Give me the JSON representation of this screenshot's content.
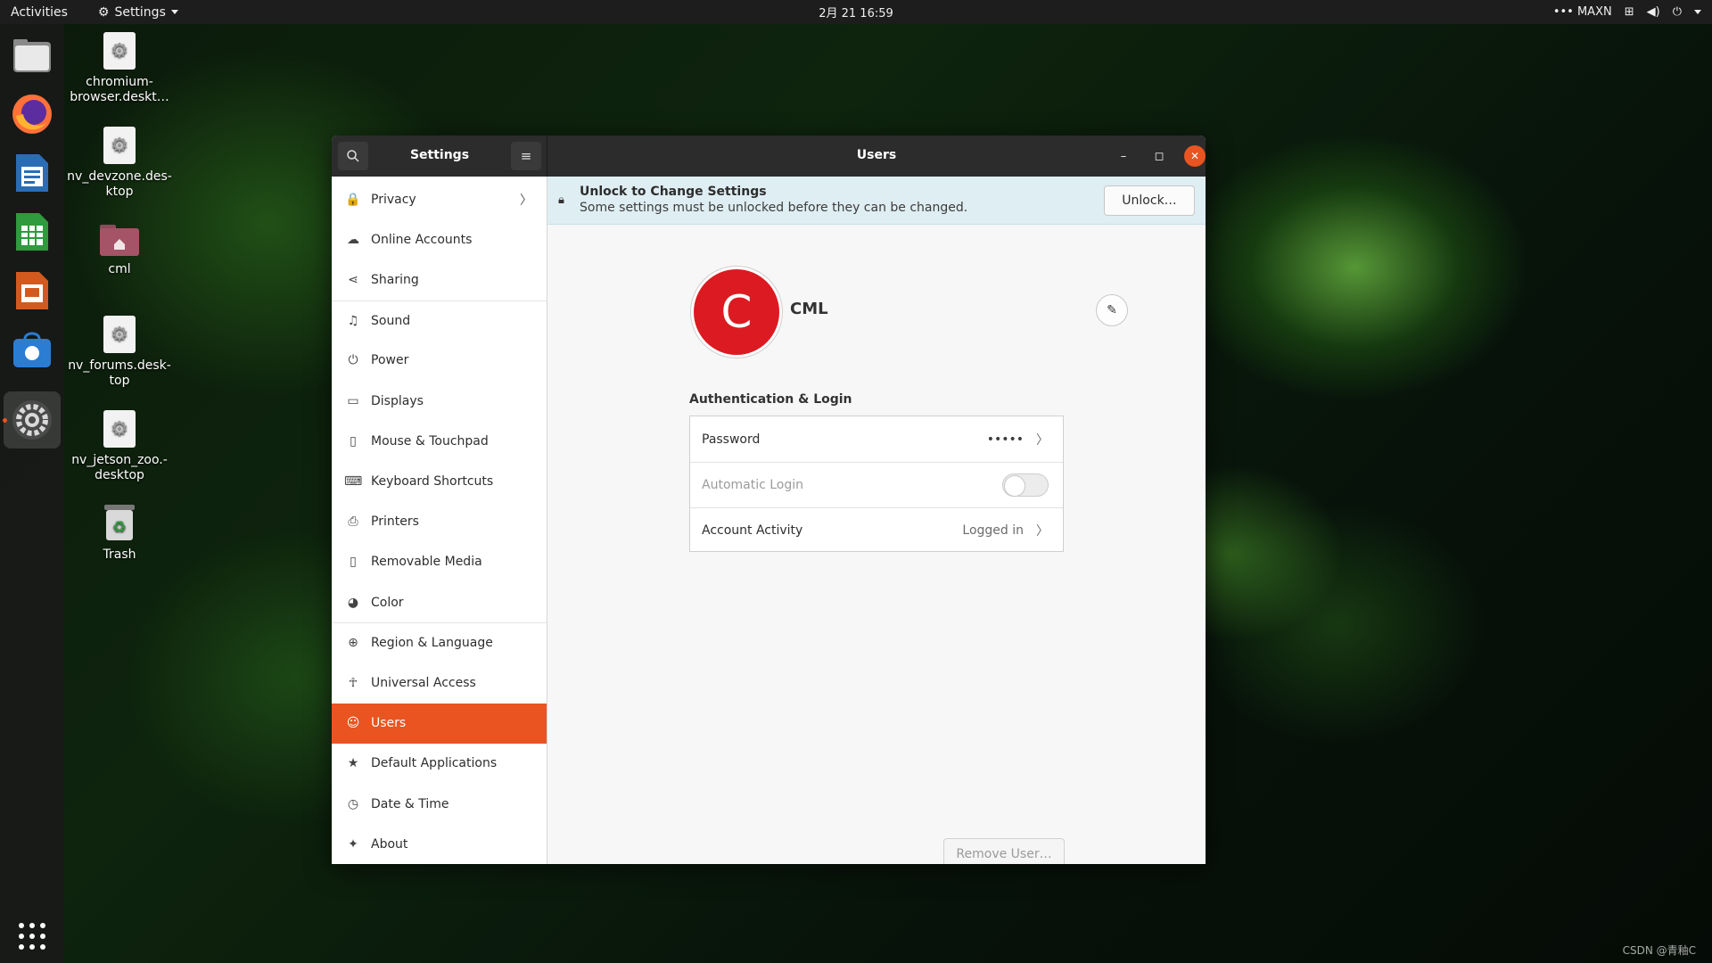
{
  "topbar": {
    "activities": "Activities",
    "app_name": "Settings",
    "clock": "2月 21  16:59",
    "power_mode": "MAXN"
  },
  "dock": {
    "items": [
      "files-icon",
      "firefox-icon",
      "writer-icon",
      "calc-icon",
      "impress-icon",
      "software-icon",
      "settings-icon"
    ],
    "show_apps": "show-apps-icon"
  },
  "desktop": {
    "icons": [
      {
        "label": "chromium-\nbrowser.deskt…"
      },
      {
        "label": "nv_devzone.des-\nktop"
      },
      {
        "label": "cml"
      },
      {
        "label": "nv_forums.desk-\ntop"
      },
      {
        "label": "nv_jetson_zoo.-\ndesktop"
      },
      {
        "label": "Trash"
      }
    ]
  },
  "window": {
    "sidebar_title": "Settings",
    "panel_title": "Users",
    "sidebar": [
      {
        "label": "Privacy",
        "icon": "lock-icon",
        "glyph": "🔒",
        "chevron": true
      },
      {
        "label": "Online Accounts",
        "icon": "cloud-icon",
        "glyph": "☁"
      },
      {
        "label": "Sharing",
        "icon": "share-icon",
        "glyph": "⋖"
      },
      {
        "label": "Sound",
        "icon": "music-icon",
        "glyph": "♫"
      },
      {
        "label": "Power",
        "icon": "power-icon",
        "glyph": "⏻"
      },
      {
        "label": "Displays",
        "icon": "display-icon",
        "glyph": "▭"
      },
      {
        "label": "Mouse & Touchpad",
        "icon": "mouse-icon",
        "glyph": "▯"
      },
      {
        "label": "Keyboard Shortcuts",
        "icon": "keyboard-icon",
        "glyph": "⌨"
      },
      {
        "label": "Printers",
        "icon": "printer-icon",
        "glyph": "⎙"
      },
      {
        "label": "Removable Media",
        "icon": "media-icon",
        "glyph": "▯"
      },
      {
        "label": "Color",
        "icon": "color-icon",
        "glyph": "◕"
      },
      {
        "label": "Region & Language",
        "icon": "globe-icon",
        "glyph": "⊕"
      },
      {
        "label": "Universal Access",
        "icon": "accessibility-icon",
        "glyph": "☥"
      },
      {
        "label": "Users",
        "icon": "user-icon",
        "glyph": "☺"
      },
      {
        "label": "Default Applications",
        "icon": "star-icon",
        "glyph": "★"
      },
      {
        "label": "Date & Time",
        "icon": "clock-icon",
        "glyph": "◷"
      },
      {
        "label": "About",
        "icon": "about-icon",
        "glyph": "✦"
      }
    ],
    "infobar": {
      "title": "Unlock to Change Settings",
      "subtitle": "Some settings must be unlocked before they can be changed.",
      "button": "Unlock…"
    },
    "user": {
      "initial": "C",
      "name": "CML",
      "avatar_color": "#db1b21"
    },
    "auth": {
      "title": "Authentication & Login",
      "rows": [
        {
          "label": "Password",
          "value": "•••••"
        },
        {
          "label": "Automatic Login",
          "value": ""
        },
        {
          "label": "Account Activity",
          "value": "Logged in"
        }
      ]
    },
    "remove_button": "Remove User…"
  },
  "watermark": "CSDN @青釉C",
  "colors": {
    "accent": "#e95420",
    "headerbar": "#2c2c2c",
    "topbar": "#1d1d1d"
  }
}
